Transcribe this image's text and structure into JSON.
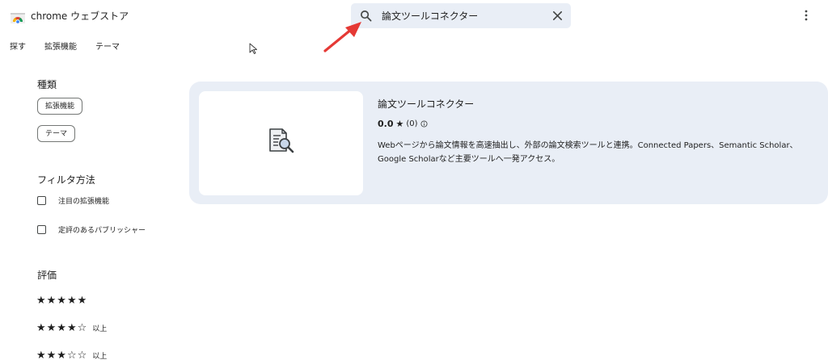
{
  "header": {
    "app_title": "chrome ウェブストア",
    "search_value": "論文ツールコネクター"
  },
  "nav": {
    "items": [
      {
        "label": "探す"
      },
      {
        "label": "拡張機能"
      },
      {
        "label": "テーマ"
      }
    ]
  },
  "sidebar": {
    "type_title": "種類",
    "type_chips": [
      {
        "label": "拡張機能"
      },
      {
        "label": "テーマ"
      }
    ],
    "filter_title": "フィルタ方法",
    "filters": [
      {
        "label": "注目の拡張機能",
        "checked": false
      },
      {
        "label": "定評のあるパブリッシャー",
        "checked": false
      }
    ],
    "rating_title": "評価",
    "ratings": [
      {
        "stars": "★★★★★",
        "suffix": ""
      },
      {
        "stars": "★★★★☆",
        "suffix": "以上"
      },
      {
        "stars": "★★★☆☆",
        "suffix": "以上"
      }
    ]
  },
  "result": {
    "name": "論文ツールコネクター",
    "rating": "0.0",
    "star": "★",
    "count": "(0)",
    "description": "Webページから論文情報を高速抽出し、外部の論文検索ツールと連携。Connected Papers、Semantic Scholar、Google Scholarなど主要ツールへ一発アクセス。"
  },
  "colors": {
    "search_bg": "#e9eef6",
    "card_bg": "#e9eef6",
    "annotation_arrow": "#e53935",
    "text": "#1f1f1f"
  },
  "icons": {
    "logo": "chrome-web-store-logo",
    "search": "search-icon",
    "clear": "close-icon",
    "more": "more-vert-icon",
    "thumb": "document-search-icon",
    "info": "info-icon"
  }
}
